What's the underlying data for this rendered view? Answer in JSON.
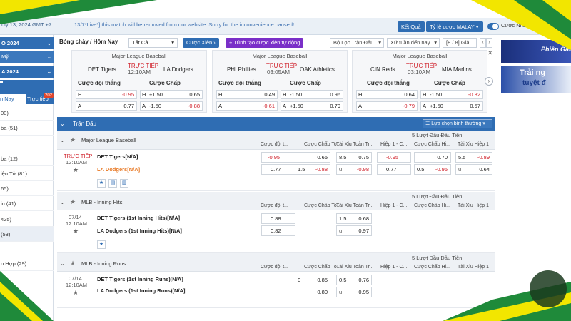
{
  "topbar": {
    "datetime": "uly 13, 2024 GMT +7",
    "notice": "13/7*Live*] this match will be removed from our website. Sorry for the inconvenience caused!",
    "result_btn": "Kết Quả",
    "odds_type": "Tỷ lệ cược MALAY",
    "quick_bet": "Cược Nhanh"
  },
  "sidebar": {
    "top_items": [
      "O 2024",
      "Mỹ",
      "A 2024"
    ],
    "tab_today": "n Nay",
    "tab_live": "Trực tiếp",
    "live_badge": "202",
    "rows": [
      "00)",
      "ba  (51)",
      "ba  (12)",
      "iện Tử  (81)",
      "65)",
      "in  (41)",
      "425)",
      "(53)",
      "n Hợp  (29)"
    ]
  },
  "toolbar": {
    "breadcrumb": "Bóng chày / Hôm Nay",
    "filter_all": "Tất Cả",
    "parlay": "Cược Xiên",
    "auto_parlay": "Trình tạo cược xiên tự động",
    "league_filter": "Bộ Lọc Trận Đấu",
    "sort": "Xữ tuần đến nay",
    "pager": "[8 / 8]",
    "pager_unit": "Giải"
  },
  "cards": [
    {
      "league": "Major League Baseball",
      "home": "DET Tigers",
      "away": "LA Dodgers",
      "live": "TRỰC TIẾP",
      "time": "12:10AM",
      "h1": "Cược đội thắng",
      "h2": "Cược Chấp",
      "h_label": "H",
      "a_label": "A",
      "h_ml": "-0.95",
      "a_ml": "0.77",
      "h_line": "+1.50",
      "h_hc": "0.65",
      "a_line": "-1.50",
      "a_hc": "-0.88"
    },
    {
      "league": "Major League Baseball",
      "home": "PHI Phillies",
      "away": "OAK Athletics",
      "live": "TRỰC TIẾP",
      "time": "03:05AM",
      "h1": "Cược đội thắng",
      "h2": "Cược Chấp",
      "h_label": "H",
      "a_label": "A",
      "h_ml": "0.49",
      "a_ml": "-0.61",
      "h_line": "-1.50",
      "h_hc": "0.96",
      "a_line": "+1.50",
      "a_hc": "0.79"
    },
    {
      "league": "Major League Baseball",
      "home": "CIN Reds",
      "away": "MIA Marlins",
      "live": "TRỰC TIẾP",
      "time": "03:10AM",
      "h1": "Cược đội thắng",
      "h2": "Cược Chấp",
      "h_label": "H",
      "a_label": "A",
      "h_ml": "0.64",
      "a_ml": "-0.79",
      "h_line": "-1.50",
      "h_hc": "-0.82",
      "a_line": "+1.50",
      "a_hc": "0.57"
    }
  ],
  "table": {
    "title": "Trận Đấu",
    "view_select": "Lựa chọn bình thường",
    "first5": "5 Lượt Đầu Đầu Tiên",
    "cols": [
      "Cược đội t...",
      "Cược Chấp To...",
      "Tài Xỉu Toàn Tr...",
      "Hiệp 1 - C...",
      "Cược Chấp Hi...",
      "Tài Xỉu Hiệp 1"
    ],
    "sections": [
      {
        "league": "Major League Baseball",
        "live": "TRỰC TIẾP",
        "time": "12:10AM",
        "home": "DET Tigers[N/A]",
        "away": "LA Dodgers[N/A]",
        "home_odds": [
          "-0.95",
          "0.65",
          "8.5",
          "0.75",
          "-0.95",
          "0.70",
          "5.5",
          "-0.89"
        ],
        "away_odds": [
          "0.77",
          "1.5",
          "-0.88",
          "u",
          "-0.98",
          "0.77",
          "0.5",
          "-0.95",
          "u",
          "0.64"
        ]
      },
      {
        "league": "MLB - Inning Hits",
        "date": "07/14",
        "time": "12:10AM",
        "home": "DET Tigers (1st Inning Hits)[N/A]",
        "away": "LA Dodgers (1st Inning Hits)[N/A]",
        "home_odds": [
          "0.88",
          "1.5",
          "0.68"
        ],
        "away_odds": [
          "0.82",
          "u",
          "0.97"
        ]
      },
      {
        "league": "MLB - Inning Runs",
        "date": "07/14",
        "time": "12:10AM",
        "home": "DET Tigers (1st Inning Runs)[N/A]",
        "away": "LA Dodgers (1st Inning Runs)[N/A]",
        "home_odds": [
          "0",
          "0.85",
          "0.5",
          "0.76"
        ],
        "away_odds": [
          "0.80",
          "u",
          "0.95"
        ]
      }
    ]
  },
  "banners": {
    "top_text": "Phiên Galaxy",
    "bottom_text1": "Trải ng",
    "bottom_text2": "tuyệt đ"
  },
  "colors": {
    "brand_blue": "#2f6db3",
    "live_red": "#d0202a",
    "away_orange": "#e87722",
    "frame_yellow": "#f2e600",
    "frame_green": "#1f8a3a"
  }
}
